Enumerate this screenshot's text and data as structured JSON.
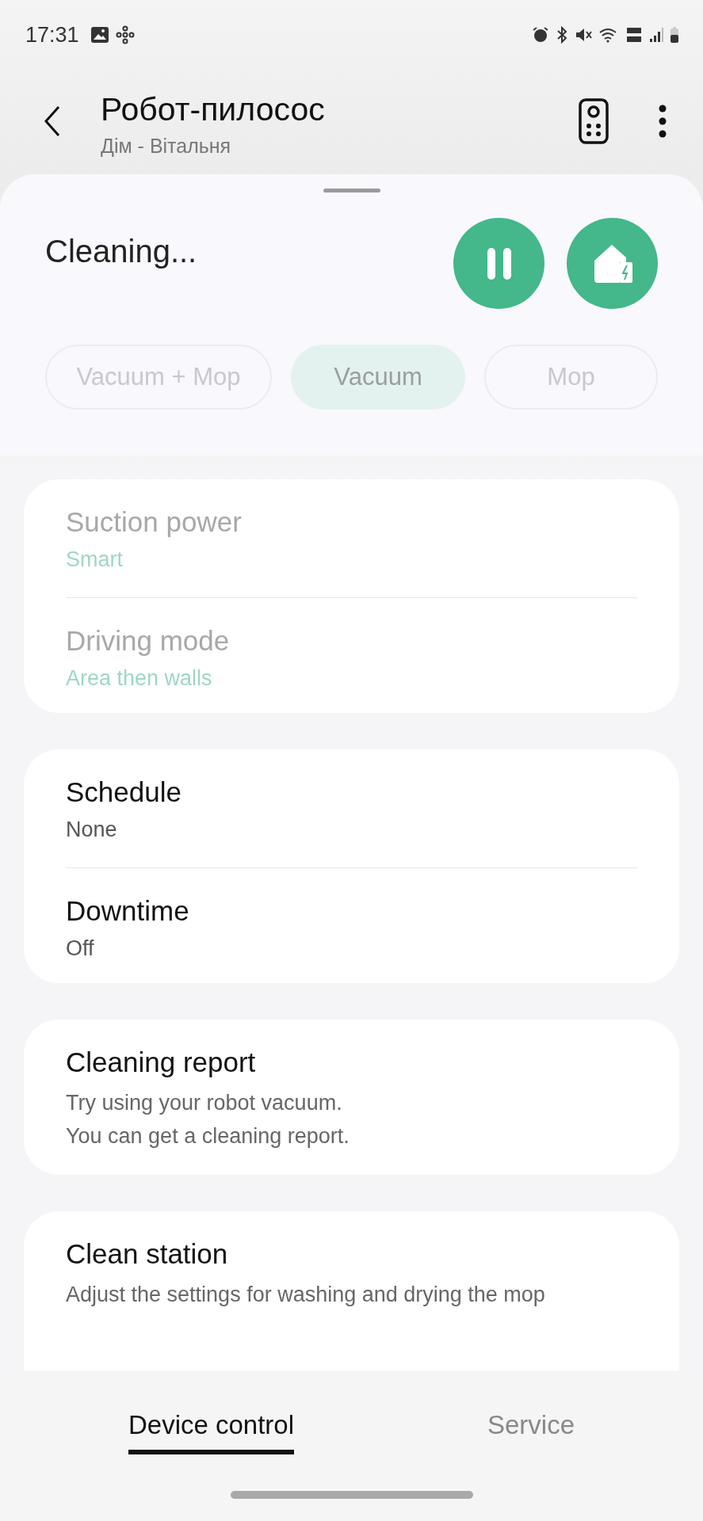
{
  "status_bar": {
    "time": "17:31"
  },
  "header": {
    "title": "Робот-пилосос",
    "subtitle": "Дім - Вітальня"
  },
  "status": {
    "text": "Cleaning..."
  },
  "modes": [
    {
      "label": "Vacuum + Mop",
      "selected": false
    },
    {
      "label": "Vacuum",
      "selected": true
    },
    {
      "label": "Mop",
      "selected": false
    }
  ],
  "modes_disabled": true,
  "cards": [
    {
      "items": [
        {
          "title": "Suction power",
          "value": "Smart",
          "disabled": true
        },
        {
          "title": "Driving mode",
          "value": "Area then walls",
          "disabled": true
        }
      ]
    },
    {
      "items": [
        {
          "title": "Schedule",
          "value": "None",
          "disabled": false
        },
        {
          "title": "Downtime",
          "value": "Off",
          "disabled": false
        }
      ]
    },
    {
      "items": [
        {
          "title": "Cleaning report",
          "description": [
            "Try using your robot vacuum.",
            "You can get a cleaning report."
          ],
          "disabled": false
        }
      ]
    },
    {
      "items": [
        {
          "title": "Clean station",
          "description": [
            "Adjust the settings for washing and drying the mop"
          ],
          "disabled": false
        }
      ]
    }
  ],
  "bottom_tabs": [
    {
      "label": "Device control",
      "selected": true
    },
    {
      "label": "Service",
      "selected": false
    }
  ]
}
